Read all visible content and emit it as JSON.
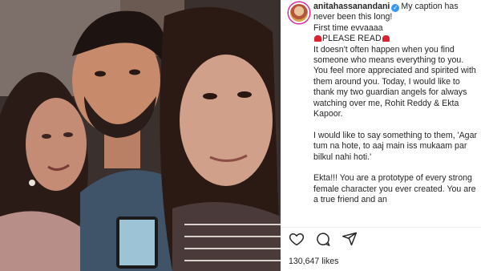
{
  "post": {
    "username": "anitahassanandani",
    "caption_first": "My caption has never been this long!",
    "caption_lines": [
      "First time evvaaaa",
      "PLEASE READ",
      "It doesn't often happen when you find someone who means everything to you. You feel more appreciated and spirited with them around you. Today, I would like to thank my two guardian angels for always watching over me, Rohit Reddy & Ekta Kapoor.",
      "",
      "I would like to say something to them, 'Agar tum na hote, to aaj main iss mukaam par bilkul nahi hoti.'",
      "",
      "Ekta!!! You are a prototype of every strong female character you ever created. You are a true friend and an"
    ],
    "likes_text": "130,647 likes"
  },
  "icons": {
    "verified": "verified-badge-icon",
    "siren": "police-siren-emoji",
    "like": "heart-icon",
    "comment": "comment-icon",
    "share": "paper-plane-icon"
  },
  "colors": {
    "verified": "#3897f0",
    "siren": "#d9232e",
    "avatar_ring": "#d6249f"
  }
}
